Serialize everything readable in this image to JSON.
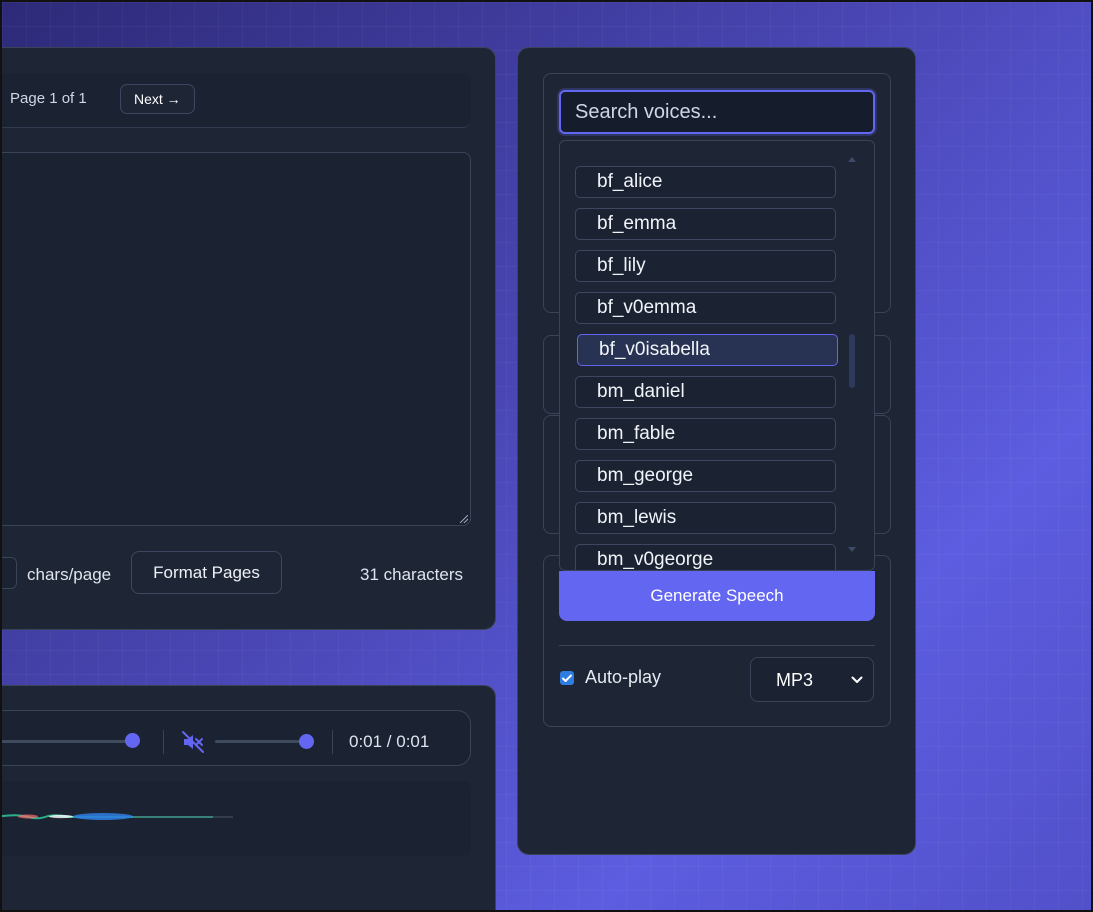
{
  "editor": {
    "page_label": "Page 1 of 1",
    "next_label": "Next →",
    "chars_per_page_label": "chars/page",
    "format_pages_label": "Format Pages",
    "char_count": "31 characters"
  },
  "player": {
    "time": "0:01 / 0:01",
    "muted": true
  },
  "voices": {
    "search_placeholder": "Search voices...",
    "items": [
      {
        "label": "bf_alice"
      },
      {
        "label": "bf_emma"
      },
      {
        "label": "bf_lily"
      },
      {
        "label": "bf_v0emma"
      },
      {
        "label": "bf_v0isabella"
      },
      {
        "label": "bm_daniel"
      },
      {
        "label": "bm_fable"
      },
      {
        "label": "bm_george"
      },
      {
        "label": "bm_lewis"
      },
      {
        "label": "bm_v0george"
      }
    ],
    "selected": "bf_v0isabella",
    "generate_label": "Generate Speech",
    "autoplay_label": "Auto-play",
    "autoplay_checked": true,
    "format_value": "MP3"
  },
  "colors": {
    "accent": "#6366f1",
    "panel": "#1e2535",
    "checkbox": "#2f7de1"
  }
}
